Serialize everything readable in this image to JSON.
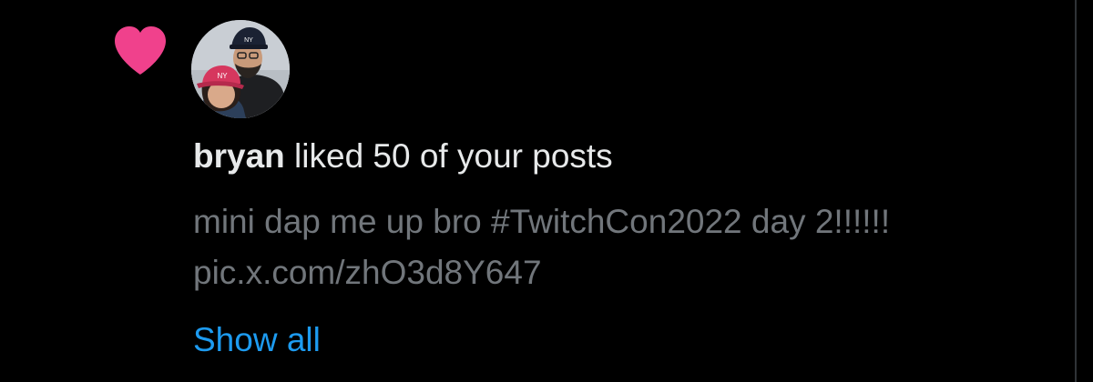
{
  "notification": {
    "icon": "heart-icon",
    "icon_color": "#f0418c",
    "avatar": "user-avatar-photo",
    "username": "bryan",
    "action_text": " liked 50 of your posts",
    "post_text": "mini dap me up bro #TwitchCon2022 day 2!!!!!! pic.x.com/zhO3d8Y647",
    "show_all_label": "Show all",
    "link_color": "#1d9bf0"
  }
}
